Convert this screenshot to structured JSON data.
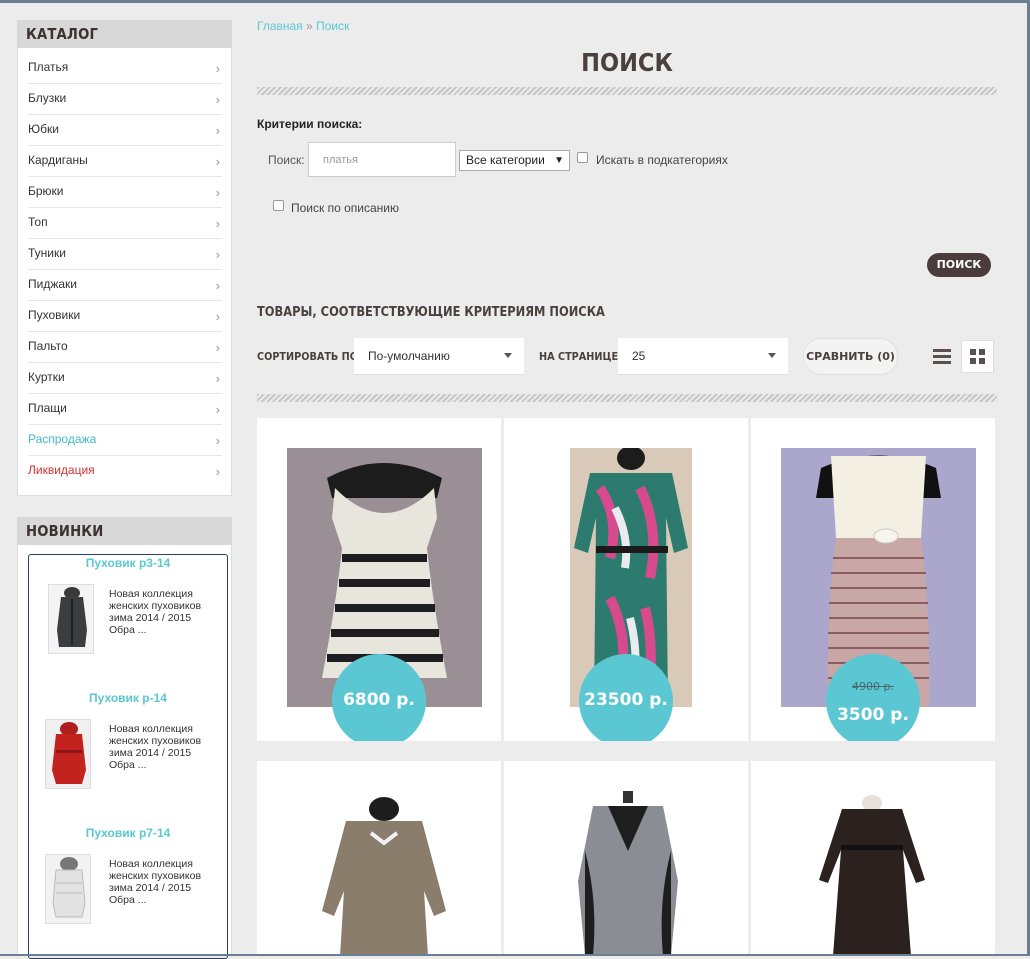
{
  "sidebar": {
    "catalog_title": "КАТАЛОГ",
    "items": [
      {
        "label": "Платья"
      },
      {
        "label": "Блузки"
      },
      {
        "label": "Юбки"
      },
      {
        "label": "Кардиганы"
      },
      {
        "label": "Брюки"
      },
      {
        "label": "Топ"
      },
      {
        "label": "Туники"
      },
      {
        "label": "Пиджаки"
      },
      {
        "label": "Пуховики"
      },
      {
        "label": "Пальто"
      },
      {
        "label": "Куртки"
      },
      {
        "label": "Плащи"
      },
      {
        "label": "Распродажа"
      },
      {
        "label": "Ликвидация"
      }
    ],
    "new_title": "НОВИНКИ",
    "new_items": [
      {
        "title": "Пуховик р3-14",
        "text": "Новая коллекция женских пуховиков зима 2014 / 2015 Обра ..."
      },
      {
        "title": "Пуховик р-14",
        "text": "Новая коллекция женских пуховиков зима 2014 / 2015 Обра ..."
      },
      {
        "title": "Пуховик р7-14",
        "text": "Новая коллекция женских пуховиков зима 2014 / 2015 Обра ..."
      }
    ]
  },
  "breadcrumb": {
    "home": "Главная",
    "sep": "»",
    "current": "Поиск"
  },
  "page_title": "ПОИСК",
  "search": {
    "criteria_label": "Критерии поиска:",
    "search_label": "Поиск:",
    "query_value": "платья",
    "category_value": "Все категории",
    "subcategories_label": "Искать в подкатегориях",
    "description_label": "Поиск по описанию",
    "button_label": "ПОИСК"
  },
  "results": {
    "heading": "ТОВАРЫ, СООТВЕТСТВУЮЩИЕ КРИТЕРИЯМ ПОИСКА",
    "sort_label": "СОРТИРОВАТЬ ПО:",
    "sort_value": "По-умолчанию",
    "perpage_label": "НА СТРАНИЦЕ:",
    "perpage_value": "25",
    "compare_label": "СРАВНИТЬ (0)"
  },
  "products": [
    {
      "price": "6800 р."
    },
    {
      "price": "23500 р."
    },
    {
      "old_price": "4900 р.",
      "price": "3500 р."
    }
  ]
}
